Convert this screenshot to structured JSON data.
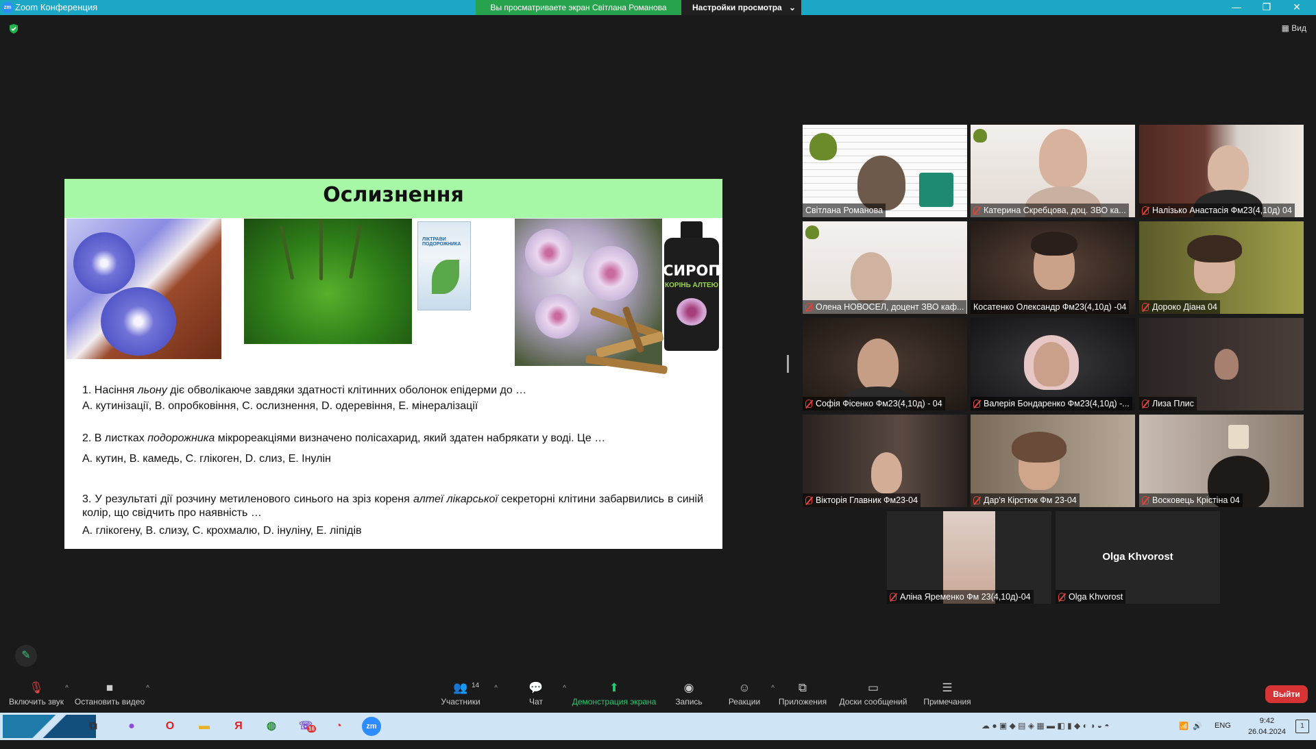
{
  "window": {
    "app_logo": "zm",
    "title": "Zoom Конференция",
    "controls": [
      "minimize-icon",
      "restore-icon",
      "close-icon"
    ]
  },
  "share_banner": {
    "message": "Вы просматриваете экран Світлана Романова",
    "options_label": "Настройки просмотра"
  },
  "view_button": "Вид",
  "slide": {
    "title": "Ослизнення",
    "syrup_label": "СИРОП",
    "syrup_sublabel": "КОРІНЬ АЛТЕЮ",
    "box_label": "ЛІКТРАВИ ПОДОРОЖНИКА",
    "q1": {
      "pre": "1. Насіння ",
      "italic": "льону",
      "post": " діє обволікаюче завдяки здатності клітинних оболонок  епідерми до …",
      "answers": "А. кутинізації,  В.  опробковіння,  С. ослизнення,  D.  одеревіння,  Е.  мінералізації"
    },
    "q2": {
      "pre": "2. В листках ",
      "italic": "подорожника",
      "post": " мікрореакціями визначено полісахарид, який здатен набрякати у воді. Це …",
      "answers": "А.  кутин,  В.  камедь,  С.  глікоген,  D. слиз,  Е.  Інулін"
    },
    "q3": {
      "pre": "3. У результаті дії розчину метиленового синього на зріз кореня ",
      "italic": "алтеї лікарської",
      "post": " секреторні клітини забарвились в синій колір, що свідчить про наявність …",
      "answers": "А. глікогену,  В. слизу,  С.  крохмалю,  D.  інуліну,  Е.  ліпідів"
    }
  },
  "participants": [
    {
      "name": "Світлана Романова",
      "muted": false
    },
    {
      "name": "Катерина Скребцова, доц. ЗВО ка...",
      "muted": true
    },
    {
      "name": "Налізько Анастасія Фм23(4,10д) 04",
      "muted": true
    },
    {
      "name": "Олена НОВОСЕЛ, доцент ЗВО каф...",
      "muted": true
    },
    {
      "name": "Косатенко Олександр Фм23(4,10д) -04",
      "muted": false
    },
    {
      "name": "Дороко Діана 04",
      "muted": true
    },
    {
      "name": "Софія Фісенко Фм23(4,10д) - 04",
      "muted": true
    },
    {
      "name": "Валерія Бондаренко Фм23(4,10д) -...",
      "muted": true
    },
    {
      "name": "Лиза Плис",
      "muted": true
    },
    {
      "name": "Вікторія Главник Фм23-04",
      "muted": true
    },
    {
      "name": "Дар'я Кірстюк Фм 23-04",
      "muted": true
    },
    {
      "name": "Восковець Крістіна 04",
      "muted": true
    },
    {
      "name": "Аліна Яременко Фм 23(4,10д)-04",
      "muted": true
    },
    {
      "name": "Olga Khvorost",
      "muted": true,
      "display_name": "Olga Khvorost"
    }
  ],
  "toolbar": {
    "unmute": "Включить звук",
    "stop_video": "Остановить видео",
    "participants": "Участники",
    "participants_count": "14",
    "chat": "Чат",
    "share_screen": "Демонстрация экрана",
    "record": "Запись",
    "reactions": "Реакции",
    "apps": "Приложения",
    "whiteboards": "Доски сообщений",
    "notes": "Примечания",
    "leave": "Выйти"
  },
  "taskbar": {
    "language": "ENG",
    "time": "9:42",
    "date": "26.04.2024",
    "notif_count": "1",
    "viber_badge": "16"
  },
  "colors": {
    "titlebar": "#1ca7c4",
    "banner_green": "#28a34d",
    "slide_header": "#a6f7a6",
    "leave_red": "#d63434",
    "active_speaker": "#d6e634"
  }
}
